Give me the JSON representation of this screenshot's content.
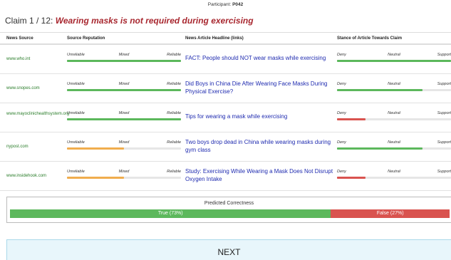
{
  "participant": {
    "label": "Participant:",
    "id": "P042"
  },
  "claim": {
    "prefix": "Claim 1 / 12:",
    "text": "Wearing masks is not required during exercising"
  },
  "table": {
    "headers": {
      "source": "News Source",
      "reputation": "Source Reputation",
      "headline": "News Article Headline (links)",
      "stance": "Stance of Article Towards Claim"
    },
    "reputation_scale": [
      "Unreliable",
      "Mixed",
      "Reliable"
    ],
    "stance_scale": [
      "Deny",
      "Neutral",
      "Support"
    ],
    "rows": [
      {
        "source": "www.who.int",
        "reputation": 1.0,
        "reputation_color": "#5cb85c",
        "headline": "FACT: People should NOT wear masks while exercising",
        "stance": 1.0,
        "stance_color": "#5cb85c"
      },
      {
        "source": "www.snopes.com",
        "reputation": 1.0,
        "reputation_color": "#5cb85c",
        "headline": "Did Boys in China Die After Wearing Face Masks During Physical Exercise?",
        "stance": 0.75,
        "stance_color": "#5cb85c"
      },
      {
        "source": "www.mayoclinichealthsystem.org",
        "reputation": 1.0,
        "reputation_color": "#5cb85c",
        "headline": "Tips for wearing a mask while exercising",
        "stance": 0.25,
        "stance_color": "#d9534f"
      },
      {
        "source": "nypost.com",
        "reputation": 0.5,
        "reputation_color": "#f0ad4e",
        "headline": "Two boys drop dead in China while wearing masks during gym class",
        "stance": 0.75,
        "stance_color": "#5cb85c"
      },
      {
        "source": "www.insidehook.com",
        "reputation": 0.5,
        "reputation_color": "#f0ad4e",
        "headline": "Study: Exercising While Wearing a Mask Does Not Disrupt Oxygen Intake",
        "stance": 0.25,
        "stance_color": "#d9534f"
      }
    ]
  },
  "prediction": {
    "title": "Predicted Correctness",
    "true_label": "True (73%)",
    "true_pct": 73,
    "false_label": "False (27%)",
    "false_pct": 27,
    "colors": {
      "true": "#5cb85c",
      "false": "#d9534f"
    }
  },
  "next_button": {
    "label": "NEXT"
  }
}
